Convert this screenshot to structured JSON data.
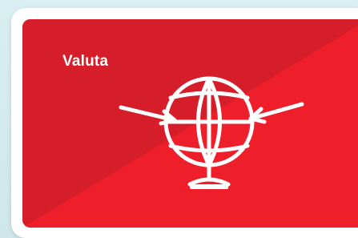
{
  "card": {
    "title": "Valuta"
  },
  "icons": {
    "main": "globe-icon",
    "left_arrow": "arrow-right-icon",
    "right_arrow": "arrow-left-icon"
  },
  "colors": {
    "card_red": "#ee1f2b",
    "card_dark": "#d41f2a",
    "icon_white": "#ffffff",
    "background": "#d9eef0"
  }
}
